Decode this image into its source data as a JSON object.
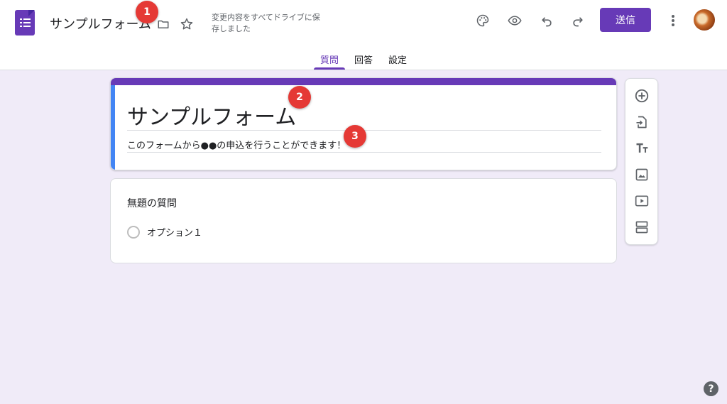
{
  "header": {
    "document_title": "サンプルフォーム",
    "save_status": "変更内容をすべてドライブに保存しました",
    "send_label": "送信",
    "icons": [
      "forms-logo-icon",
      "folder-icon",
      "star-icon",
      "palette-icon",
      "eye-icon",
      "undo-icon",
      "redo-icon",
      "more-vert-icon",
      "avatar"
    ]
  },
  "tabs": [
    {
      "label": "質問",
      "active": true
    },
    {
      "label": "回答",
      "active": false
    },
    {
      "label": "設定",
      "active": false
    }
  ],
  "form": {
    "title": "サンプルフォーム",
    "description": "このフォームから●●の申込を行うことができます！"
  },
  "question": {
    "title": "無題の質問",
    "option_label": "オプション１"
  },
  "side_toolbar": [
    "add-question-icon",
    "import-icon",
    "title-text-icon",
    "image-icon",
    "video-icon",
    "section-icon"
  ],
  "markers": [
    "1",
    "2",
    "3"
  ],
  "help_label": "?",
  "colors": {
    "accent": "#673ab7",
    "background": "#f0ebf8",
    "left_band": "#4285f4",
    "marker": "#e53935"
  }
}
